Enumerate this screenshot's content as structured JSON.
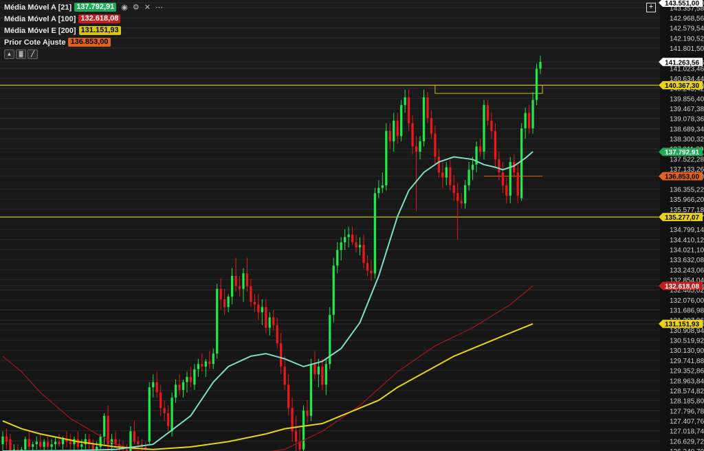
{
  "legend": {
    "items": [
      {
        "label": "Média Móvel A [21]",
        "value": "137.792,91",
        "color": "#1faa55",
        "fg": "#ffffff"
      },
      {
        "label": "Média Móvel A [100]",
        "value": "132.618,08",
        "color": "#c0201e",
        "fg": "#ffffff"
      },
      {
        "label": "Média Móvel E [200]",
        "value": "131.151,93",
        "color": "#d7c80c",
        "fg": "#000000"
      },
      {
        "label": "Prior Cote Ajuste",
        "value": "136.853,00",
        "color": "#e0621e",
        "fg": "#000000"
      }
    ],
    "header_icons": [
      "eye-off-icon",
      "gear-icon",
      "close-icon",
      "more-icon"
    ],
    "tool_icons": [
      "collapse-up-icon",
      "chart-type-icon",
      "draw-tool-icon"
    ]
  },
  "toolbar": {
    "add_icon": "plus-square-icon"
  },
  "colors": {
    "up": "#22e64a",
    "down": "#e8191c",
    "ma21": "#7de0c4",
    "ma100": "#a1181b",
    "ema200": "#e5d80f",
    "hline": "#d8bb14",
    "prior": "#e0621e",
    "grid": "#2b2b2b",
    "axis_text": "#d2d2d2"
  },
  "chart_data": {
    "type": "candlestick",
    "y_axis": {
      "min": 126240,
      "max": 143551,
      "position": "right",
      "tick_labels": [
        "143.551,00",
        "143.357,58",
        "142.968,56",
        "142.579,54",
        "142.190,52",
        "141.801,50",
        "141.263,56",
        "141.023,46",
        "140.634,44",
        "140.367,30",
        "140.245,42",
        "139.856,40",
        "139.467,38",
        "139.078,36",
        "138.689,34",
        "138.300,32",
        "137.911,30",
        "137.792,91",
        "137.522,28",
        "137.133,26",
        "136.853,00",
        "136.355,22",
        "135.966,20",
        "135.577,18",
        "135.277,07",
        "134.799,14",
        "134.410,12",
        "134.021,10",
        "133.632,08",
        "133.243,06",
        "132.854,04",
        "132.465,02",
        "132.618,08",
        "132.076,00",
        "131.686,98",
        "131.297,96",
        "131.151,93",
        "130.908,94",
        "130.519,92",
        "130.130,90",
        "129.741,88",
        "129.352,86",
        "128.963,84",
        "128.574,82",
        "128.185,80",
        "127.796,78",
        "127.407,76",
        "127.018,74",
        "126.629,72",
        "126.240,70"
      ]
    },
    "price_labels": [
      {
        "value": 143551,
        "text": "143.551,00",
        "bg": "#ffffff",
        "fg": "#000000"
      },
      {
        "value": 141263.56,
        "text": "141.263,56",
        "bg": "#ffffff",
        "fg": "#000000"
      },
      {
        "value": 140367.3,
        "text": "140.367,30",
        "bg": "#e8d21a",
        "fg": "#000000"
      },
      {
        "value": 137792.91,
        "text": "137.792,91",
        "bg": "#1faa55",
        "fg": "#ffffff"
      },
      {
        "value": 136853.0,
        "text": "136.853,00",
        "bg": "#e0621e",
        "fg": "#000000"
      },
      {
        "value": 135277.07,
        "text": "135.277,07",
        "bg": "#e8d21a",
        "fg": "#000000"
      },
      {
        "value": 132618.08,
        "text": "132.618,08",
        "bg": "#c0201e",
        "fg": "#ffffff"
      },
      {
        "value": 131151.93,
        "text": "131.151,93",
        "bg": "#e8d21a",
        "fg": "#000000"
      }
    ],
    "horizontal_lines": [
      140367.3,
      135277.07
    ],
    "prior_close": 136853,
    "candles": [
      [
        126500,
        127000,
        126240,
        126800
      ],
      [
        126800,
        127100,
        126300,
        126600
      ],
      [
        126700,
        126900,
        126100,
        126200
      ],
      [
        126200,
        126500,
        126000,
        126300
      ],
      [
        126300,
        126500,
        126000,
        126100
      ],
      [
        126100,
        126400,
        125900,
        126300
      ],
      [
        126300,
        126800,
        126100,
        126700
      ],
      [
        126700,
        127000,
        126300,
        126400
      ],
      [
        126400,
        126600,
        126200,
        126500
      ],
      [
        126500,
        126800,
        126300,
        126600
      ],
      [
        126600,
        126900,
        126300,
        126400
      ],
      [
        126400,
        126700,
        126200,
        126600
      ],
      [
        126600,
        126800,
        126300,
        126400
      ],
      [
        126400,
        126700,
        126200,
        126500
      ],
      [
        126500,
        126800,
        126300,
        126600
      ],
      [
        126600,
        126900,
        126400,
        126500
      ],
      [
        126500,
        126800,
        126300,
        126700
      ],
      [
        126700,
        127000,
        126400,
        126600
      ],
      [
        126600,
        126900,
        126300,
        126500
      ],
      [
        126500,
        126800,
        126200,
        126700
      ],
      [
        126700,
        127000,
        126300,
        126400
      ],
      [
        126400,
        126700,
        126200,
        126500
      ],
      [
        126500,
        126900,
        126300,
        126700
      ],
      [
        126700,
        126900,
        126300,
        126500
      ],
      [
        126500,
        126700,
        126200,
        126300
      ],
      [
        126300,
        126600,
        126100,
        126400
      ],
      [
        126400,
        126900,
        126300,
        126800
      ],
      [
        126800,
        127700,
        126500,
        127600
      ],
      [
        127600,
        128000,
        126200,
        126500
      ],
      [
        126500,
        126900,
        126200,
        126700
      ],
      [
        126700,
        127000,
        126400,
        126500
      ],
      [
        126500,
        126700,
        126200,
        126400
      ],
      [
        126400,
        126600,
        126100,
        126300
      ],
      [
        126300,
        126500,
        126000,
        126200
      ],
      [
        126200,
        127200,
        126000,
        127000
      ],
      [
        127000,
        127400,
        126500,
        126600
      ],
      [
        126600,
        126800,
        126300,
        126500
      ],
      [
        126500,
        126700,
        126200,
        126400
      ],
      [
        126400,
        126600,
        126200,
        126350
      ],
      [
        126600,
        128900,
        126500,
        128700
      ],
      [
        128700,
        129200,
        128300,
        128900
      ],
      [
        128900,
        129300,
        128300,
        128500
      ],
      [
        128500,
        128800,
        127600,
        127900
      ],
      [
        127900,
        128200,
        127400,
        127700
      ],
      [
        127700,
        128000,
        127000,
        127200
      ],
      [
        127000,
        128500,
        126800,
        128300
      ],
      [
        128300,
        129000,
        128100,
        128800
      ],
      [
        128800,
        129200,
        128400,
        128600
      ],
      [
        128600,
        129000,
        128300,
        128900
      ],
      [
        128900,
        129300,
        128500,
        129100
      ],
      [
        129100,
        129500,
        128700,
        128900
      ],
      [
        128800,
        129600,
        128600,
        129400
      ],
      [
        129400,
        129800,
        129100,
        129600
      ],
      [
        129600,
        130000,
        129300,
        129500
      ],
      [
        129500,
        129800,
        129100,
        129700
      ],
      [
        129700,
        130100,
        129400,
        129600
      ],
      [
        129600,
        130200,
        129400,
        130000
      ],
      [
        130000,
        132700,
        129800,
        132500
      ],
      [
        132500,
        132900,
        131700,
        132100
      ],
      [
        132100,
        132500,
        131500,
        131800
      ],
      [
        131800,
        132300,
        131600,
        132200
      ],
      [
        132200,
        133300,
        131900,
        133000
      ],
      [
        133000,
        133700,
        132400,
        132600
      ],
      [
        132600,
        133000,
        132200,
        132500
      ],
      [
        132500,
        133300,
        132000,
        133100
      ],
      [
        133100,
        133700,
        132400,
        132600
      ],
      [
        132600,
        132900,
        131800,
        132000
      ],
      [
        132000,
        132300,
        131600,
        131900
      ],
      [
        131900,
        132300,
        131300,
        131600
      ],
      [
        131600,
        132100,
        131100,
        131800
      ],
      [
        131800,
        132100,
        130800,
        131000
      ],
      [
        131000,
        131600,
        130700,
        131400
      ],
      [
        131400,
        131700,
        130900,
        131100
      ],
      [
        131100,
        131400,
        130200,
        130400
      ],
      [
        130400,
        130800,
        129200,
        129500
      ],
      [
        129500,
        129900,
        128600,
        128800
      ],
      [
        128800,
        129200,
        127600,
        127900
      ],
      [
        127900,
        128300,
        126600,
        127000
      ],
      [
        127000,
        127600,
        126200,
        126600
      ],
      [
        126600,
        127100,
        125800,
        126300
      ],
      [
        126300,
        128000,
        126200,
        127800
      ],
      [
        127800,
        128200,
        127300,
        127600
      ],
      [
        127600,
        129800,
        127400,
        129600
      ],
      [
        129600,
        130100,
        129000,
        129200
      ],
      [
        129200,
        129800,
        128700,
        129500
      ],
      [
        129500,
        129800,
        128600,
        128800
      ],
      [
        128800,
        129800,
        128400,
        129600
      ],
      [
        129600,
        131800,
        129400,
        131500
      ],
      [
        131500,
        133700,
        131200,
        133400
      ],
      [
        133400,
        134300,
        133100,
        134000
      ],
      [
        134000,
        134500,
        133600,
        134300
      ],
      [
        134300,
        134800,
        134000,
        134500
      ],
      [
        134500,
        134900,
        134100,
        134600
      ],
      [
        134600,
        134900,
        134200,
        134300
      ],
      [
        134300,
        134600,
        133900,
        134100
      ],
      [
        134100,
        134500,
        133800,
        134200
      ],
      [
        134200,
        134600,
        133300,
        133500
      ],
      [
        133500,
        133800,
        133000,
        133200
      ],
      [
        133200,
        133600,
        132800,
        133100
      ],
      [
        133100,
        136400,
        132900,
        136200
      ],
      [
        136200,
        136700,
        136000,
        136400
      ],
      [
        136400,
        137000,
        136200,
        136500
      ],
      [
        136500,
        138900,
        136300,
        138600
      ],
      [
        138600,
        138900,
        137900,
        138200
      ],
      [
        138200,
        139300,
        137800,
        139000
      ],
      [
        139000,
        139300,
        138100,
        138400
      ],
      [
        138400,
        139800,
        138200,
        139600
      ],
      [
        139600,
        140200,
        139300,
        139900
      ],
      [
        139900,
        140200,
        138600,
        138900
      ],
      [
        138900,
        139200,
        137700,
        138000
      ],
      [
        138000,
        138400,
        135500,
        137800
      ],
      [
        137800,
        138400,
        137500,
        138200
      ],
      [
        138200,
        140200,
        138000,
        139900
      ],
      [
        139900,
        140100,
        138900,
        139100
      ],
      [
        139100,
        139400,
        138300,
        138500
      ],
      [
        138500,
        138800,
        137300,
        137600
      ],
      [
        137600,
        137900,
        136800,
        137000
      ],
      [
        137000,
        137400,
        136400,
        136800
      ],
      [
        136800,
        137400,
        136500,
        137200
      ],
      [
        137200,
        137500,
        136300,
        136500
      ],
      [
        136500,
        136900,
        135900,
        136200
      ],
      [
        136200,
        136600,
        134400,
        135900
      ],
      [
        135900,
        136200,
        135600,
        135800
      ],
      [
        135800,
        136700,
        135600,
        136500
      ],
      [
        136500,
        137400,
        136300,
        137100
      ],
      [
        137100,
        137600,
        136700,
        137300
      ],
      [
        137300,
        138200,
        137000,
        138000
      ],
      [
        138000,
        138300,
        137600,
        137800
      ],
      [
        137800,
        139800,
        137500,
        139600
      ],
      [
        139600,
        139800,
        138800,
        139000
      ],
      [
        139000,
        139300,
        138300,
        138600
      ],
      [
        138600,
        138900,
        137200,
        137500
      ],
      [
        137500,
        137800,
        136700,
        137000
      ],
      [
        137000,
        137400,
        136200,
        136500
      ],
      [
        136500,
        136800,
        135800,
        136100
      ],
      [
        136100,
        137600,
        135800,
        137400
      ],
      [
        137400,
        137700,
        136800,
        137000
      ],
      [
        137000,
        137300,
        135800,
        136100
      ],
      [
        136000,
        138900,
        135900,
        138700
      ],
      [
        138700,
        139500,
        138300,
        139300
      ],
      [
        139300,
        139600,
        138500,
        138700
      ],
      [
        138700,
        140100,
        138500,
        139800
      ],
      [
        139800,
        141200,
        139600,
        141000
      ],
      [
        141000,
        141500,
        140800,
        141263
      ]
    ],
    "ma21": [
      [
        0,
        126240
      ],
      [
        10,
        126250
      ],
      [
        20,
        126260
      ],
      [
        30,
        126300
      ],
      [
        40,
        126500
      ],
      [
        50,
        127600
      ],
      [
        56,
        128900
      ],
      [
        60,
        129500
      ],
      [
        66,
        129900
      ],
      [
        70,
        130000
      ],
      [
        75,
        129800
      ],
      [
        80,
        129500
      ],
      [
        85,
        129700
      ],
      [
        90,
        130200
      ],
      [
        95,
        131200
      ],
      [
        100,
        133000
      ],
      [
        105,
        135300
      ],
      [
        108,
        136300
      ],
      [
        112,
        137000
      ],
      [
        116,
        137400
      ],
      [
        120,
        137600
      ],
      [
        125,
        137500
      ],
      [
        128,
        137300
      ],
      [
        131,
        137200
      ],
      [
        133,
        137100
      ],
      [
        136,
        137250
      ],
      [
        139,
        137550
      ],
      [
        141,
        137800
      ]
    ],
    "ma100": [
      [
        0,
        129900
      ],
      [
        5,
        129300
      ],
      [
        10,
        128500
      ],
      [
        18,
        127500
      ],
      [
        25,
        126900
      ],
      [
        30,
        126500
      ],
      [
        45,
        125900
      ],
      [
        60,
        126000
      ],
      [
        75,
        126300
      ],
      [
        85,
        127000
      ],
      [
        95,
        128000
      ],
      [
        105,
        129300
      ],
      [
        115,
        130300
      ],
      [
        125,
        131000
      ],
      [
        135,
        131900
      ],
      [
        141,
        132618
      ]
    ],
    "ema200": [
      [
        0,
        127400
      ],
      [
        5,
        127100
      ],
      [
        10,
        126900
      ],
      [
        20,
        126600
      ],
      [
        30,
        126400
      ],
      [
        40,
        126300
      ],
      [
        50,
        126400
      ],
      [
        60,
        126600
      ],
      [
        70,
        126900
      ],
      [
        75,
        127100
      ],
      [
        80,
        127200
      ],
      [
        85,
        127300
      ],
      [
        90,
        127600
      ],
      [
        95,
        127900
      ],
      [
        100,
        128200
      ],
      [
        105,
        128700
      ],
      [
        110,
        129100
      ],
      [
        115,
        129500
      ],
      [
        120,
        129900
      ],
      [
        125,
        130200
      ],
      [
        130,
        130500
      ],
      [
        135,
        130800
      ],
      [
        141,
        131152
      ]
    ]
  }
}
